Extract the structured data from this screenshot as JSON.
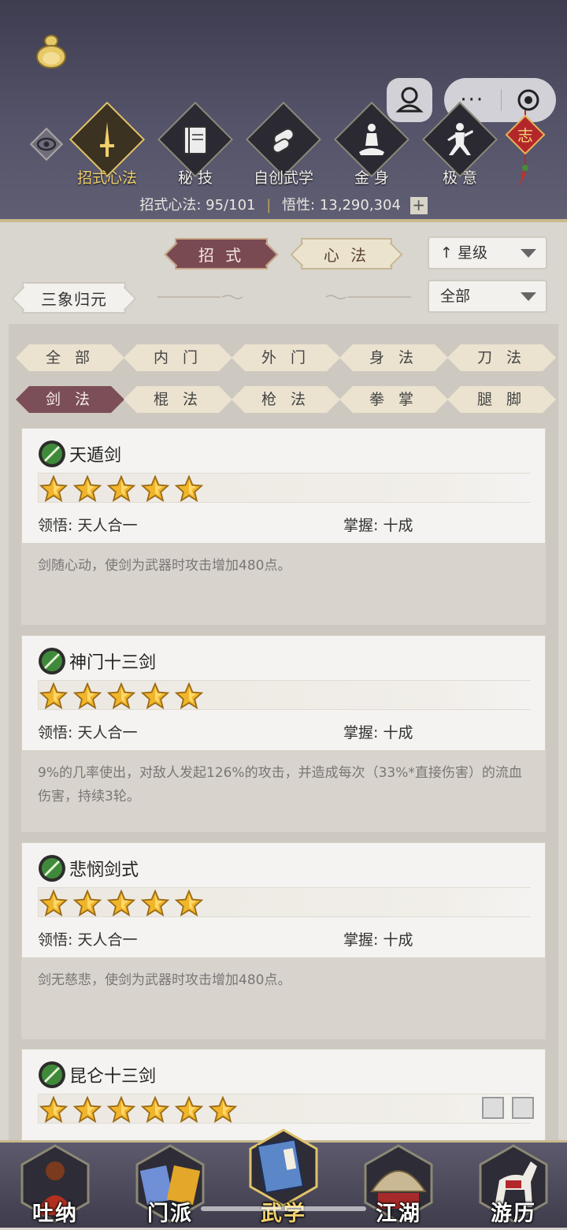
{
  "header": {
    "top_tabs": [
      {
        "label": "招式心法",
        "icon": "sword-icon",
        "active": true
      },
      {
        "label": "秘 技",
        "icon": "book-icon",
        "active": false
      },
      {
        "label": "自创武学",
        "icon": "scroll-icon",
        "active": false
      },
      {
        "label": "金 身",
        "icon": "meditation-icon",
        "active": false
      },
      {
        "label": "极 意",
        "icon": "martial-stance-icon",
        "active": false
      }
    ],
    "knot_char": "志",
    "stats": {
      "moves_label": "招式心法:",
      "moves_value": "95/101",
      "insight_label": "悟性:",
      "insight_value": "13,290,304",
      "plus": "+"
    },
    "capsule_more": "···"
  },
  "toolbar": {
    "moves_tab": "招 式",
    "method_tab": "心 法",
    "sort_dropdown": "星级",
    "sort_arrow": "↑",
    "formation_button": "三象归元",
    "scope_dropdown": "全部"
  },
  "filters": [
    {
      "label": "全 部",
      "active": false
    },
    {
      "label": "内 门",
      "active": false
    },
    {
      "label": "外 门",
      "active": false
    },
    {
      "label": "身 法",
      "active": false
    },
    {
      "label": "刀 法",
      "active": false
    },
    {
      "label": "剑 法",
      "active": true
    },
    {
      "label": "棍 法",
      "active": false
    },
    {
      "label": "枪 法",
      "active": false
    },
    {
      "label": "拳 掌",
      "active": false
    },
    {
      "label": "腿 脚",
      "active": false
    }
  ],
  "skills": [
    {
      "name": "天遁剑",
      "stars": 5,
      "insight_label": "领悟:",
      "insight": "天人合一",
      "mastery_label": "掌握:",
      "mastery": "十成",
      "description": "剑随心动，使剑为武器时攻击增加480点。"
    },
    {
      "name": "神门十三剑",
      "stars": 5,
      "insight_label": "领悟:",
      "insight": "天人合一",
      "mastery_label": "掌握:",
      "mastery": "十成",
      "description": "9%的几率使出，对敌人发起126%的攻击，并造成每次（33%*直接伤害）的流血伤害，持续3轮。"
    },
    {
      "name": "悲悯剑式",
      "stars": 5,
      "insight_label": "领悟:",
      "insight": "天人合一",
      "mastery_label": "掌握:",
      "mastery": "十成",
      "description": "剑无慈悲，使剑为武器时攻击增加480点。"
    },
    {
      "name": "昆仑十三剑",
      "stars": 6,
      "insight_label": "",
      "insight": "",
      "mastery_label": "",
      "mastery": "",
      "description": ""
    }
  ],
  "bottom_nav": [
    {
      "label": "吐纳",
      "icon": "monk-icon",
      "active": false
    },
    {
      "label": "门派",
      "icon": "sect-banner-icon",
      "active": false
    },
    {
      "label": "武学",
      "icon": "manual-book-icon",
      "active": true
    },
    {
      "label": "江湖",
      "icon": "straw-hat-icon",
      "active": false
    },
    {
      "label": "游历",
      "icon": "horse-icon",
      "active": false
    }
  ],
  "colors": {
    "accent_gold": "#f1d06b",
    "active_tab": "#7b4e58",
    "header_bg": "#4a4960"
  }
}
